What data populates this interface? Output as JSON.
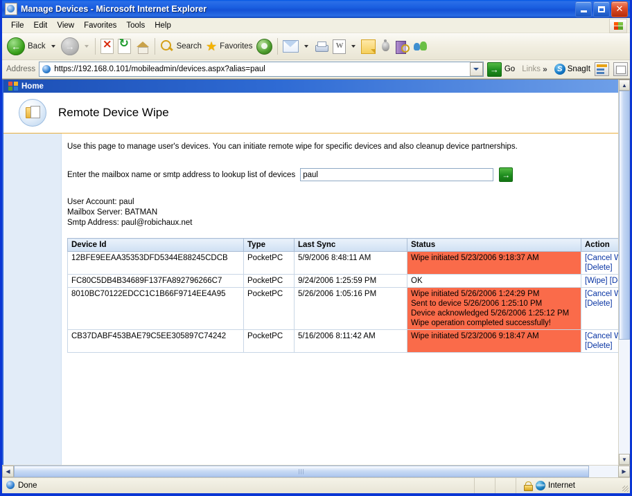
{
  "window": {
    "title": "Manage Devices - Microsoft Internet Explorer",
    "minimize_label": "Minimize",
    "maximize_label": "Maximize",
    "close_label": "Close"
  },
  "menu": {
    "items": [
      "File",
      "Edit",
      "View",
      "Favorites",
      "Tools",
      "Help"
    ]
  },
  "toolbar": {
    "back_label": "Back",
    "forward_label": "Forward",
    "stop_label": "Stop",
    "refresh_label": "Refresh",
    "home_label": "Home",
    "search_label": "Search",
    "favorites_label": "Favorites",
    "media_label": "Media",
    "mail_label": "Mail",
    "print_label": "Print",
    "edit_word_label": "Edit with Word",
    "notes_label": "Notes",
    "messenger_label": "Messenger",
    "research_label": "Research",
    "discuss_label": "Discuss"
  },
  "address": {
    "label": "Address",
    "url": "https://192.168.0.101/mobileadmin/devices.aspx?alias=paul",
    "go_label": "Go",
    "links_label": "Links",
    "snagit_label": "SnagIt"
  },
  "page": {
    "home_crumb": "Home",
    "title": "Remote Device Wipe",
    "intro": "Use this page to manage user's devices. You can initiate remote wipe for specific devices and also cleanup device partnerships.",
    "lookup_label": "Enter the mailbox name or smtp address to lookup list of devices",
    "lookup_value": "paul",
    "lookup_placeholder": "",
    "lookup_go_label": "Go",
    "account": {
      "user_account": "User Account: paul",
      "mailbox_server": "Mailbox Server: BATMAN",
      "smtp_address": "Smtp Address: paul@robichaux.net"
    },
    "table": {
      "headers": [
        "Device Id",
        "Type",
        "Last Sync",
        "Status",
        "Action"
      ],
      "rows": [
        {
          "device_id": "12BFE9EEAA35353DFD5344E88245CDCB",
          "type": "PocketPC",
          "last_sync": "5/9/2006 8:48:11 AM",
          "status": "Wipe initiated 5/23/2006 9:18:37 AM",
          "status_alert": true,
          "actions": [
            "[Cancel Wipe]",
            "[Delete]"
          ]
        },
        {
          "device_id": "FC80C5DB4B34689F137FA892796266C7",
          "type": "PocketPC",
          "last_sync": "9/24/2006 1:25:59 PM",
          "status": "OK",
          "status_alert": false,
          "actions": [
            "[Wipe]",
            "[Delete]"
          ]
        },
        {
          "device_id": "8010BC70122EDCC1C1B66F9714EE4A95",
          "type": "PocketPC",
          "last_sync": "5/26/2006 1:05:16 PM",
          "status": "Wipe initiated 5/26/2006 1:24:29 PM Sent to device 5/26/2006 1:25:10 PM Device acknowledged 5/26/2006 1:25:12 PM Wipe operation completed successfully!",
          "status_lines": [
            "Wipe initiated 5/26/2006 1:24:29 PM",
            "Sent to device 5/26/2006 1:25:10 PM",
            "Device acknowledged 5/26/2006 1:25:12 PM",
            "Wipe operation completed successfully!"
          ],
          "status_alert": true,
          "actions": [
            "[Cancel Wipe]",
            "[Delete]"
          ]
        },
        {
          "device_id": "CB37DABF453BAE79C5EE305897C74242",
          "type": "PocketPC",
          "last_sync": "5/16/2006 8:11:42 AM",
          "status": "Wipe initiated 5/23/2006 9:18:47 AM",
          "status_alert": true,
          "actions": [
            "[Cancel Wipe]",
            "[Delete]"
          ]
        }
      ]
    }
  },
  "statusbar": {
    "status": "Done",
    "zone": "Internet",
    "secure": true
  },
  "colors": {
    "title_blue": "#1452d6",
    "alert_bg": "#fa6b4a",
    "link_blue": "#0733a3",
    "sidebar_blue": "#e2ecf8",
    "table_header": "#cfe0f3"
  }
}
